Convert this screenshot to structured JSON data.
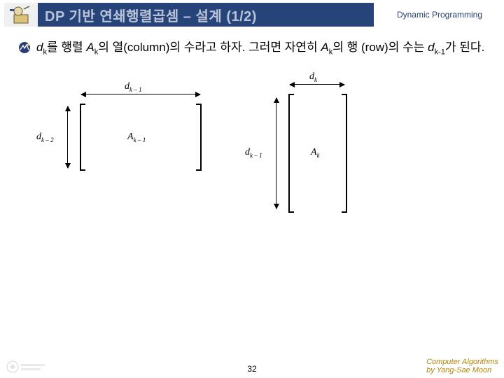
{
  "header": {
    "title": "DP 기반 연쇄행렬곱셈 – 설계 (1/2)",
    "subtitle": "Dynamic Programming"
  },
  "body": {
    "p1_a": "d",
    "p1_b": "k",
    "p1_c": "를 행렬 ",
    "p1_d": "A",
    "p1_e": "k",
    "p1_f": "의 열(column)의 수라고 하자. 그러면 자연히 ",
    "p1_g": "A",
    "p1_h": "k",
    "p1_i": "의 행 (row)의 수는 ",
    "p1_j": "d",
    "p1_k": "k-1",
    "p1_l": "가 된다."
  },
  "diagram": {
    "dk_minus1_top": "d",
    "dk_minus1_top_sub": "k – 1",
    "dk_minus2": "d",
    "dk_minus2_sub": "k – 2",
    "Ak_minus1": "A",
    "Ak_minus1_sub": "k – 1",
    "dk_top": "d",
    "dk_top_sub": "k",
    "dk_minus1_side": "d",
    "dk_minus1_side_sub": "k – 1",
    "Ak": "A",
    "Ak_sub": "k"
  },
  "footer": {
    "page": "32",
    "credit1": "Computer Algorithms",
    "credit2": "by Yang-Sae Moon"
  }
}
